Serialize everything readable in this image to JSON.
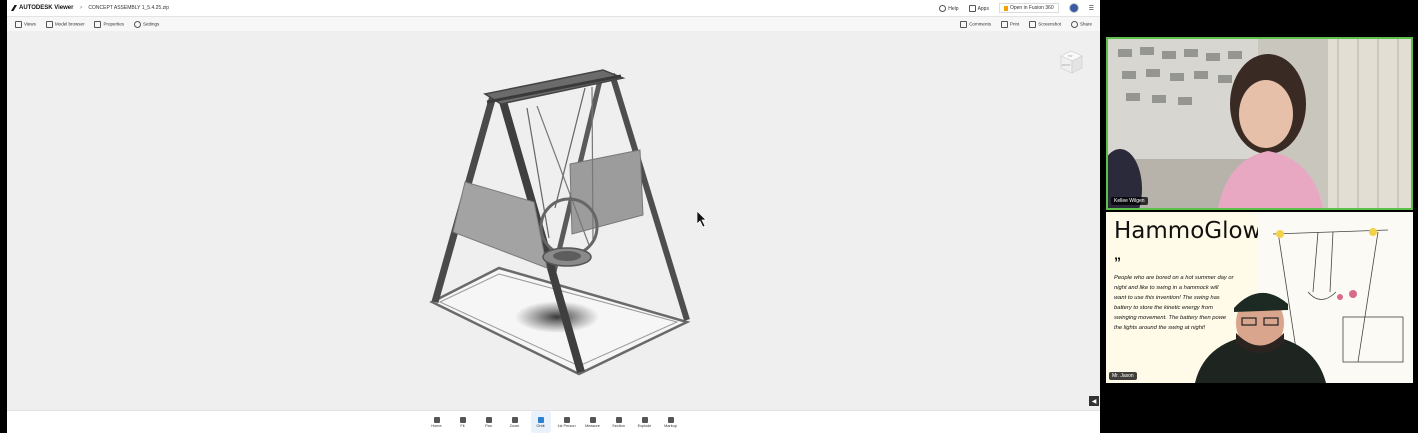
{
  "viewer": {
    "brand": "AUTODESK Viewer",
    "breadcrumb_separator": ">",
    "file_name": "CONCEPT ASSEMBLY 1_5.4.25.zip",
    "top_right": {
      "help": "Help",
      "apps": "Apps",
      "open_in_fusion": "Open in Fusion 360"
    },
    "secondary_left": [
      "Views",
      "Model browser",
      "Properties",
      "Settings"
    ],
    "secondary_right": [
      "Comments",
      "Print",
      "Screenshot",
      "Share"
    ],
    "bottom_tools": [
      "Home",
      "Fit",
      "Pan",
      "Zoom",
      "Orbit",
      "1st Person",
      "Measure",
      "Section",
      "Explode",
      "Markup"
    ],
    "active_tool": "Orbit",
    "viewcube_labels": [
      "TOP",
      "FRONT"
    ],
    "colors": {
      "accent": "#2d7fcf",
      "canvas": "#efefef"
    }
  },
  "participants": [
    {
      "name": "Kellee Wilgen",
      "active_speaker": true,
      "highlight_color": "#5cc04a"
    },
    {
      "name": "Mr. Jason"
    }
  ],
  "slide": {
    "title": "HammoGlow",
    "quote_mark": "”",
    "quote_lines": [
      "People who are bored on a hot summer day or",
      "night and like to swing in a hammock will",
      "want to use this invention! The swing has",
      "battery to store the kinetic energy from",
      "swinging movement. The battery then powe",
      "the lights around the swing at night!"
    ]
  }
}
